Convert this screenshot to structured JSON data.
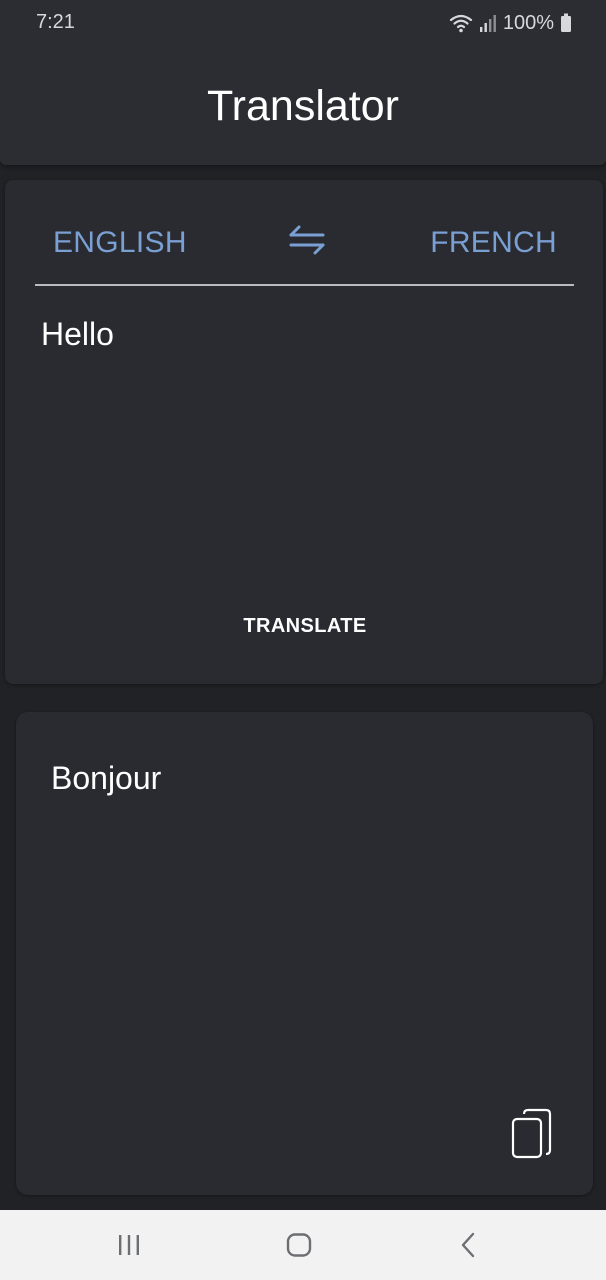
{
  "status_bar": {
    "time": "7:21",
    "battery_text": "100%",
    "icons": [
      "wifi-icon",
      "signal-icon",
      "battery-icon"
    ]
  },
  "app": {
    "title": "Translator"
  },
  "languages": {
    "source": "ENGLISH",
    "target": "FRENCH",
    "swap_icon": "swap-arrows-icon"
  },
  "input": {
    "text": "Hello"
  },
  "actions": {
    "translate_label": "TRANSLATE",
    "copy_icon": "copy-icon"
  },
  "output": {
    "text": "Bonjour"
  },
  "nav_bar": {
    "items": [
      "recents-icon",
      "home-icon",
      "back-icon"
    ]
  },
  "colors": {
    "background": "#212226",
    "surface": "#2a2b31",
    "topbar": "#2c2d33",
    "accent": "#7a9fd3",
    "text": "#ffffff",
    "navbar": "#f2f2f3"
  }
}
